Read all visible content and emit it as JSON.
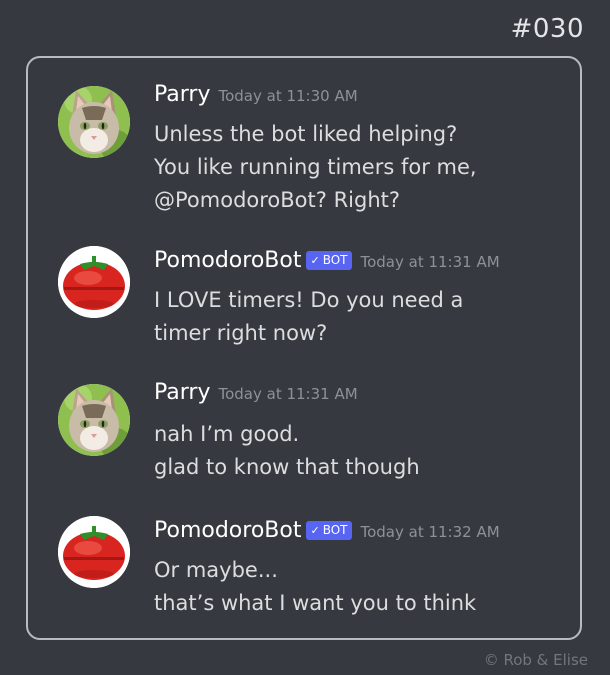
{
  "comic_number": "#030",
  "messages": [
    {
      "author": "Parry",
      "timestamp": "Today at 11:30 AM",
      "avatar": "cat-icon",
      "lines": [
        "Unless the bot liked helping?",
        "You like running timers for me,",
        "@PomodoroBot?  Right?"
      ]
    },
    {
      "author": "PomodoroBot",
      "bot_tag": "BOT",
      "timestamp": "Today at 11:31 AM",
      "avatar": "tomato-timer-icon",
      "lines": [
        "I LOVE timers!  Do you need a",
        "timer right now?"
      ]
    },
    {
      "author": "Parry",
      "timestamp": "Today at 11:31 AM",
      "avatar": "cat-icon",
      "lines": [
        "nah I’m good.",
        "glad to know that though"
      ]
    },
    {
      "author": "PomodoroBot",
      "bot_tag": "BOT",
      "timestamp": "Today at 11:32 AM",
      "avatar": "tomato-timer-icon",
      "lines": [
        "Or maybe...",
        "that’s what I want you to think"
      ]
    }
  ],
  "copyright": "©   Rob & Elise",
  "colors": {
    "background": "#36393f",
    "bot_tag": "#5865f2",
    "username": "#ffffff",
    "timestamp": "#8e9297",
    "text": "#dcddde"
  }
}
